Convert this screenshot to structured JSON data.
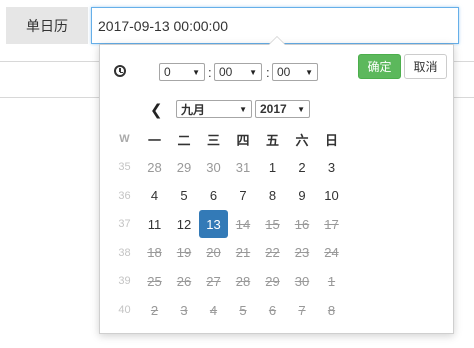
{
  "label": "单日历",
  "input": {
    "value": "2017-09-13 00:00:00"
  },
  "time": {
    "hour": "0",
    "minute": "00",
    "second": "00"
  },
  "buttons": {
    "ok": "确定",
    "cancel": "取消"
  },
  "nav": {
    "month": "九月",
    "year": "2017"
  },
  "calendar": {
    "week_header": "W",
    "weekdays": [
      "一",
      "二",
      "三",
      "四",
      "五",
      "六",
      "日"
    ],
    "rows": [
      {
        "week": "35",
        "days": [
          {
            "d": "28",
            "s": "other"
          },
          {
            "d": "29",
            "s": "other"
          },
          {
            "d": "30",
            "s": "other"
          },
          {
            "d": "31",
            "s": "other"
          },
          {
            "d": "1",
            "s": "norm"
          },
          {
            "d": "2",
            "s": "norm"
          },
          {
            "d": "3",
            "s": "norm"
          }
        ]
      },
      {
        "week": "36",
        "days": [
          {
            "d": "4",
            "s": "norm"
          },
          {
            "d": "5",
            "s": "norm"
          },
          {
            "d": "6",
            "s": "norm"
          },
          {
            "d": "7",
            "s": "norm"
          },
          {
            "d": "8",
            "s": "norm"
          },
          {
            "d": "9",
            "s": "norm"
          },
          {
            "d": "10",
            "s": "norm"
          }
        ]
      },
      {
        "week": "37",
        "days": [
          {
            "d": "11",
            "s": "norm"
          },
          {
            "d": "12",
            "s": "norm"
          },
          {
            "d": "13",
            "s": "selected"
          },
          {
            "d": "14",
            "s": "dis"
          },
          {
            "d": "15",
            "s": "dis"
          },
          {
            "d": "16",
            "s": "dis"
          },
          {
            "d": "17",
            "s": "dis"
          }
        ]
      },
      {
        "week": "38",
        "days": [
          {
            "d": "18",
            "s": "dis"
          },
          {
            "d": "19",
            "s": "dis"
          },
          {
            "d": "20",
            "s": "dis"
          },
          {
            "d": "21",
            "s": "dis"
          },
          {
            "d": "22",
            "s": "dis"
          },
          {
            "d": "23",
            "s": "dis"
          },
          {
            "d": "24",
            "s": "dis"
          }
        ]
      },
      {
        "week": "39",
        "days": [
          {
            "d": "25",
            "s": "dis"
          },
          {
            "d": "26",
            "s": "dis"
          },
          {
            "d": "27",
            "s": "dis"
          },
          {
            "d": "28",
            "s": "dis"
          },
          {
            "d": "29",
            "s": "dis"
          },
          {
            "d": "30",
            "s": "dis"
          },
          {
            "d": "1",
            "s": "dis"
          }
        ]
      },
      {
        "week": "40",
        "days": [
          {
            "d": "2",
            "s": "dis"
          },
          {
            "d": "3",
            "s": "dis"
          },
          {
            "d": "4",
            "s": "dis"
          },
          {
            "d": "5",
            "s": "dis"
          },
          {
            "d": "6",
            "s": "dis"
          },
          {
            "d": "7",
            "s": "dis"
          },
          {
            "d": "8",
            "s": "dis"
          }
        ]
      }
    ]
  },
  "colors": {
    "accent": "#337ab7",
    "ok_button": "#5cb85c",
    "focus_border": "#66afe9"
  }
}
